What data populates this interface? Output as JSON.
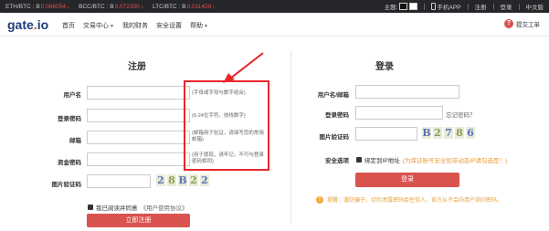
{
  "ticker": [
    {
      "pair": "ETH/BTC :",
      "currency": "B",
      "value": "0.066054",
      "arrow": "↓"
    },
    {
      "pair": "BCC/BTC :",
      "currency": "B",
      "value": "0.072300",
      "arrow": "↓"
    },
    {
      "pair": "LTC/BTC :",
      "currency": "B",
      "value": "0.011420",
      "arrow": "↓"
    }
  ],
  "topbar": {
    "theme_label": "主题:",
    "app_label": "手机APP",
    "register_label": "注册",
    "login_label": "登录",
    "language_label": "中文版"
  },
  "nav": {
    "logo_main": "gate",
    "logo_dot": ".",
    "logo_tld": "io",
    "items": [
      "首页",
      "交易中心",
      "我的财务",
      "安全设置",
      "帮助"
    ],
    "help_icon": "?",
    "help_label": "提交工单"
  },
  "register": {
    "title": "注册",
    "fields": [
      {
        "label": "用户名",
        "hint": "(字母或字母与数字组合)"
      },
      {
        "label": "登录密码",
        "hint": "(6-24位字符，技线数字)"
      },
      {
        "label": "邮箱",
        "hint": "(邮箱用于验证，请填写您的常用邮箱)"
      },
      {
        "label": "资金密码",
        "hint": "(用于提现，请牢记，不可与登录密码相同)"
      },
      {
        "label": "图片验证码",
        "hint": ""
      }
    ],
    "captcha": [
      "2",
      "8",
      "B",
      "2",
      "2"
    ],
    "agree_label": "我已阅读并同意",
    "agree_link": "《用户使用协议》",
    "submit_label": "立即注册"
  },
  "login": {
    "title": "登录",
    "username_label": "用户名/邮箱",
    "password_label": "登录密码",
    "forgot_label": "忘记密码？",
    "captcha_label": "图片验证码",
    "captcha": [
      "B",
      "2",
      "7",
      "8",
      "6"
    ],
    "security_label": "安全选项",
    "bind_ip_label": "绑定到IP地址",
    "bind_ip_warning": "(为保证账号安全如非动态IP请勾选是！)",
    "submit_label": "登录",
    "notice": "提醒：谨防骗子，切勿泄露密码给任何人，官方从不会向用户询问密码。"
  },
  "colors": {
    "accent": "#d9534f",
    "ticker_bg": "#25262a",
    "annotation": "#e8272b"
  }
}
